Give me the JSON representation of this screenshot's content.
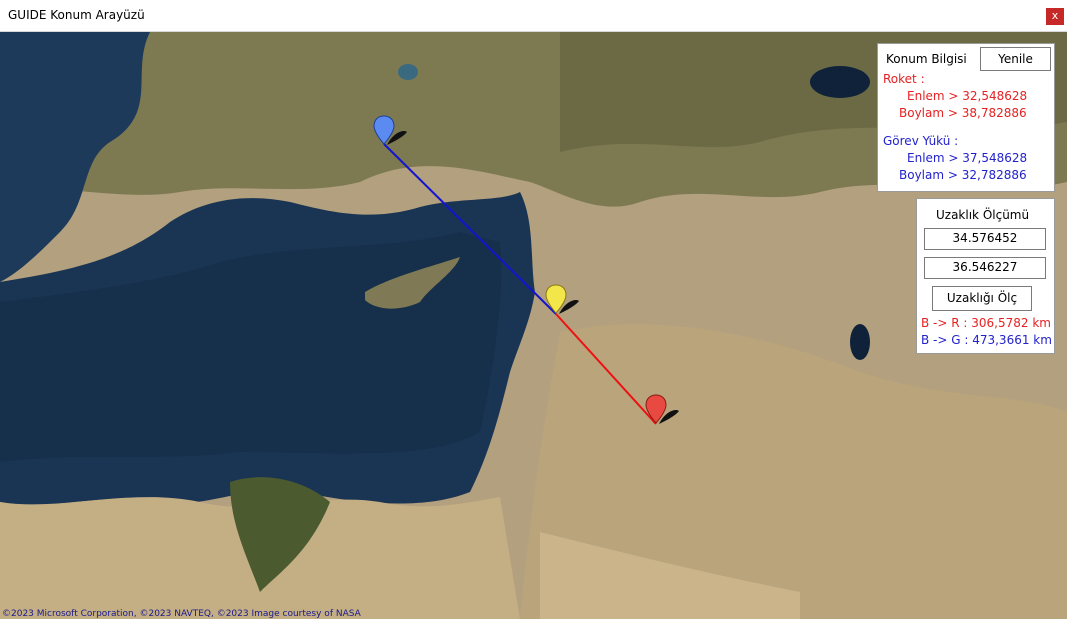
{
  "window": {
    "title": "GUIDE Konum Arayüzü",
    "close_label": "x"
  },
  "map": {
    "credit": "©2023 Microsoft Corporation, ©2023 NAVTEQ, ©2023 Image courtesy of NASA",
    "markers": [
      {
        "name": "blue-marker",
        "color": "#5b8af0"
      },
      {
        "name": "yellow-marker",
        "color": "#f2e64a"
      },
      {
        "name": "red-marker",
        "color": "#e84a42"
      }
    ],
    "lines": [
      {
        "name": "blue-line",
        "color": "#1414d0"
      },
      {
        "name": "red-line",
        "color": "#ee1111"
      }
    ]
  },
  "konum": {
    "header": "Konum Bilgisi",
    "refresh_label": "Yenile",
    "roket": {
      "title": "Roket :",
      "enlem": "Enlem > 32,548628",
      "boylam": "Boylam > 38,782886"
    },
    "gorev": {
      "title": "Görev Yükü :",
      "enlem": "Enlem > 37,548628",
      "boylam": "Boylam > 32,782886"
    }
  },
  "uzaklik": {
    "header": "Uzaklık Ölçümü",
    "field1": "34.576452",
    "field2": "36.546227",
    "measure_label": "Uzaklığı Ölç",
    "result_r": "B -> R : 306,5782 km",
    "result_g": "B -> G : 473,3661 km"
  },
  "colors": {
    "red_text": "#e52222",
    "blue_text": "#2222cc"
  }
}
